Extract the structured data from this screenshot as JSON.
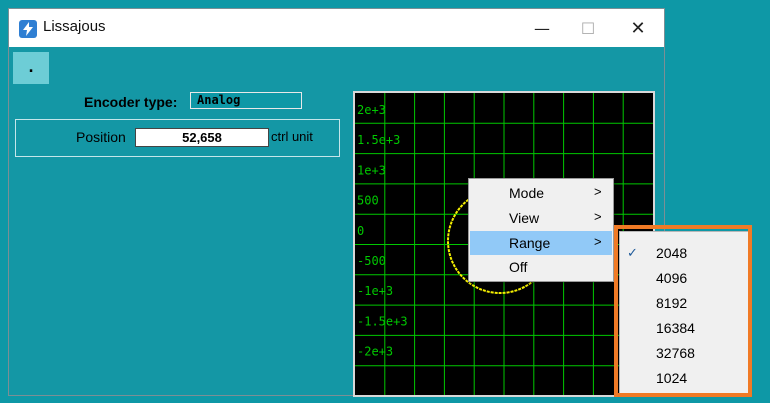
{
  "window": {
    "title": "Lissajous",
    "min_glyph": "—",
    "max_glyph": "☐",
    "close_glyph": "✕"
  },
  "toolbar": {
    "menu_label": "."
  },
  "encoder": {
    "label": "Encoder type:",
    "value": "Analog"
  },
  "position": {
    "label": "Position",
    "value": "52,658",
    "unit": "ctrl unit"
  },
  "scope": {
    "y_tick_labels": [
      "2e+3",
      "1.5e+3",
      "1e+3",
      "500",
      "0",
      "-500",
      "-1e+3",
      "-1.5e+3",
      "-2e+3"
    ],
    "grid_color": "#00c800",
    "trace_color": "#f5f000",
    "background": "#000000"
  },
  "context_menu": {
    "items": [
      {
        "label": "Mode",
        "has_submenu": true
      },
      {
        "label": "View",
        "has_submenu": true
      },
      {
        "label": "Range",
        "has_submenu": true
      },
      {
        "label": "Off",
        "has_submenu": false
      }
    ],
    "arrow_glyph": ">"
  },
  "range_menu": {
    "check_glyph": "✓",
    "selected": "2048",
    "options": [
      "2048",
      "4096",
      "8192",
      "16384",
      "32768",
      "1024"
    ]
  },
  "colors": {
    "accent_teal": "#1497a5",
    "menu_highlight": "#91c9f7",
    "callout_orange": "#f07a25"
  }
}
